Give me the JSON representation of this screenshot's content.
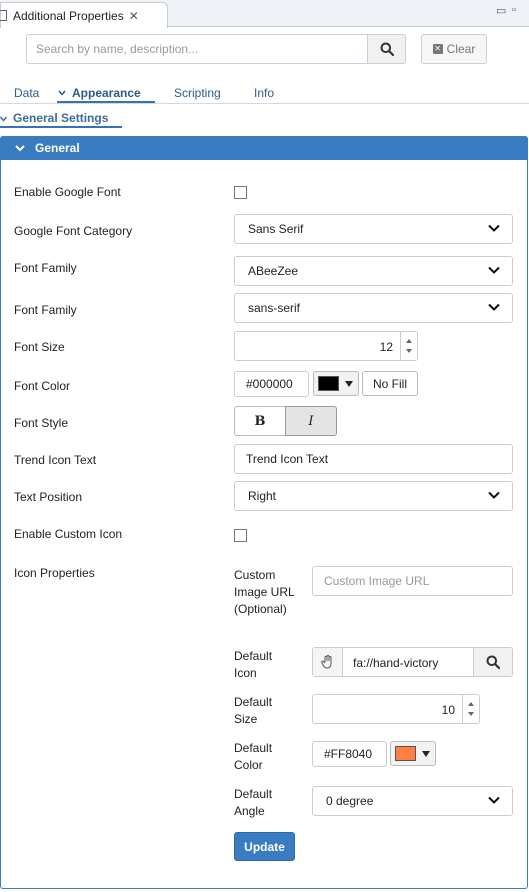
{
  "view": {
    "title": "Additional Properties",
    "close_glyph": "✕",
    "minimize_glyph": "▭",
    "maximize_glyph": "▫"
  },
  "search": {
    "placeholder": "Search by name, description...",
    "value": "",
    "clear_label": "Clear"
  },
  "tabs": [
    {
      "label": "Data",
      "active": false
    },
    {
      "label": "Appearance",
      "active": true
    },
    {
      "label": "Scripting",
      "active": false
    },
    {
      "label": "Info",
      "active": false
    }
  ],
  "section": {
    "title": "General Settings"
  },
  "panel": {
    "title": "General"
  },
  "fields": {
    "enable_google_font": {
      "label": "Enable Google Font",
      "checked": false
    },
    "google_font_category": {
      "label": "Google Font Category",
      "value": "Sans Serif"
    },
    "font_family_1": {
      "label": "Font Family",
      "value": "ABeeZee"
    },
    "font_family_2": {
      "label": "Font Family",
      "value": "sans-serif"
    },
    "font_size": {
      "label": "Font Size",
      "value": "12"
    },
    "font_color": {
      "label": "Font Color",
      "value": "#000000",
      "swatch": "#000000",
      "no_fill_label": "No Fill"
    },
    "font_style": {
      "label": "Font Style",
      "bold_label": "B",
      "italic_label": "I",
      "bold_active": false,
      "italic_active": true
    },
    "trend_icon_text": {
      "label": "Trend Icon Text",
      "value": "Trend Icon Text"
    },
    "text_position": {
      "label": "Text Position",
      "value": "Right"
    },
    "enable_custom_icon": {
      "label": "Enable Custom Icon",
      "checked": false
    },
    "icon_properties": {
      "label": "Icon Properties",
      "custom_image_url": {
        "label": "Custom Image URL (Optional)",
        "placeholder": "Custom Image URL",
        "value": ""
      },
      "default_icon": {
        "label": "Default Icon",
        "value": "fa://hand-victory"
      },
      "default_size": {
        "label": "Default Size",
        "value": "10"
      },
      "default_color": {
        "label": "Default Color",
        "value": "#FF8040",
        "swatch": "#FF8040"
      },
      "default_angle": {
        "label": "Default Angle",
        "value": "0 degree"
      }
    }
  },
  "update_label": "Update",
  "colors": {
    "accent": "#3A7CC1",
    "tab_text": "#2C5B8A"
  }
}
